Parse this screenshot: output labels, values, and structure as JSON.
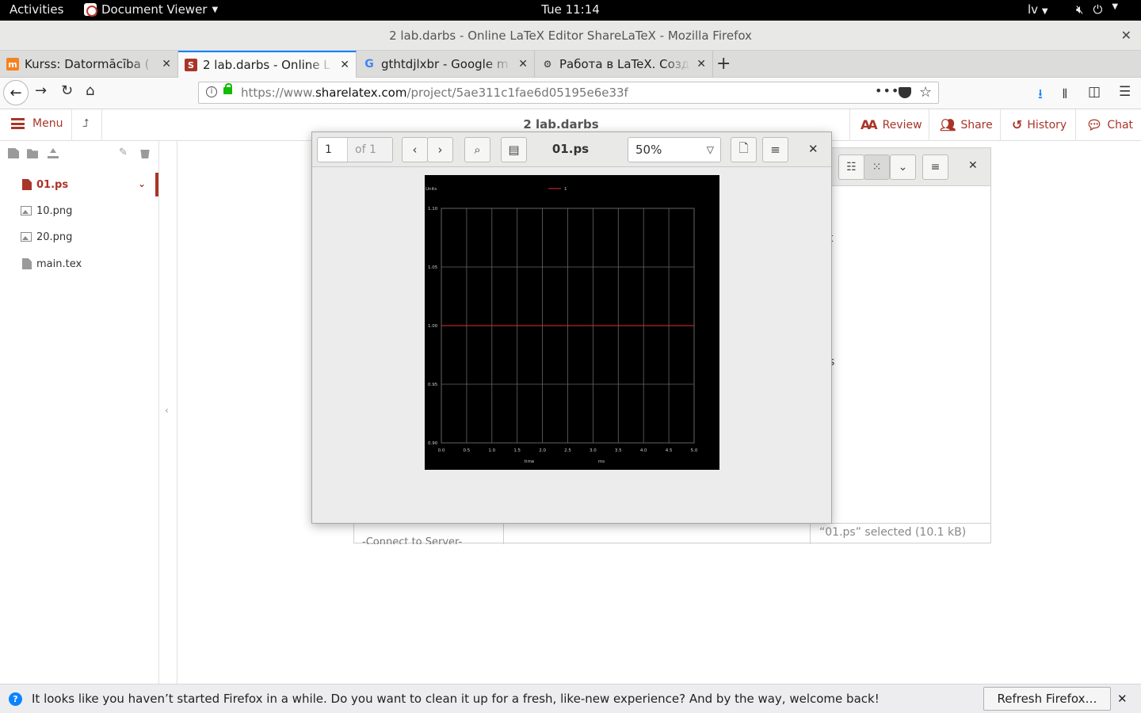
{
  "topbar": {
    "activities": "Activities",
    "app_name": "Document Viewer",
    "clock": "Tue 11:14",
    "language": "lv"
  },
  "window": {
    "title": "2 lab.darbs - Online LaTeX Editor ShareLaTeX - Mozilla Firefox"
  },
  "tabs": [
    {
      "label": "Kurss: Datormācība (",
      "favicon": "moodle-icon",
      "active": false
    },
    {
      "label": "2 lab.darbs - Online L",
      "favicon": "sharelatex-icon",
      "active": true
    },
    {
      "label": "gthtdjlxbr - Google m",
      "favicon": "google-icon",
      "active": false
    },
    {
      "label": "Работа в LaTeX. Созд",
      "favicon": "site-icon",
      "active": false
    }
  ],
  "url": {
    "prefix": "https://www.",
    "domain": "sharelatex.com",
    "path": "/project/5ae311c1fae6d05195e6e33f"
  },
  "sharelatex": {
    "menu": "Menu",
    "project_title": "2 lab.darbs",
    "review": "Review",
    "share": "Share",
    "history": "History",
    "chat": "Chat",
    "accent": "#a93529"
  },
  "files": [
    {
      "name": "01.ps",
      "type": "doc",
      "selected": true
    },
    {
      "name": "10.png",
      "type": "image",
      "selected": false
    },
    {
      "name": "20.png",
      "type": "image",
      "selected": false
    },
    {
      "name": "main.tex",
      "type": "file",
      "selected": false
    }
  ],
  "file_manager": {
    "glyph1": "t",
    "glyph2": "s",
    "connect": "-Connect to Server-",
    "status": "“01.ps” selected (10.1 kB)"
  },
  "viewer": {
    "page_current": "1",
    "page_of": "of 1",
    "doc_name": "01.ps",
    "zoom": "50%"
  },
  "chart_data": {
    "type": "line",
    "ylabel": "Units",
    "xlabel": "time",
    "xunit": "ms",
    "x": [
      0.0,
      0.5,
      1.0,
      1.5,
      2.0,
      2.5,
      3.0,
      3.5,
      4.0,
      4.5,
      5.0
    ],
    "x_ticks": [
      "0.0",
      "0.5",
      "1.0",
      "1.5",
      "2.0",
      "2.5",
      "3.0",
      "3.5",
      "4.0",
      "4.5",
      "5.0"
    ],
    "y_ticks": [
      "0.90",
      "0.95",
      "1.00",
      "1.05",
      "1.10"
    ],
    "xlim": [
      0,
      5
    ],
    "ylim": [
      0.9,
      1.1
    ],
    "grid": true,
    "legend": "top-center",
    "series": [
      {
        "name": "1",
        "color": "#e03030",
        "values": [
          1.0,
          1.0,
          1.0,
          1.0,
          1.0,
          1.0,
          1.0,
          1.0,
          1.0,
          1.0,
          1.0
        ]
      }
    ]
  },
  "notification": {
    "message": "It looks like you haven’t started Firefox in a while. Do you want to clean it up for a fresh, like-new experience? And by the way, welcome back!",
    "button": "Refresh Firefox…"
  }
}
